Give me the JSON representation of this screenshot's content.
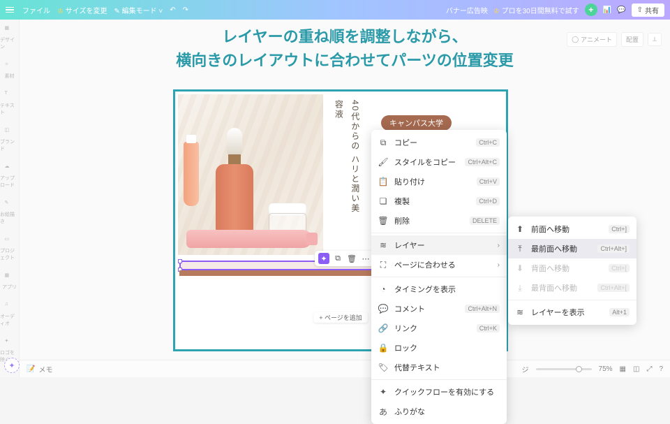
{
  "topbar": {
    "file": "ファイル",
    "resize": "サイズを変更",
    "edit_mode": "編集モード",
    "project_name": "バナー広告映",
    "pro_trial": "プロを30日間無料で試す",
    "share": "共有"
  },
  "sidebar": {
    "items": [
      {
        "label": "デザイン",
        "icon": "design"
      },
      {
        "label": "素材",
        "icon": "elements"
      },
      {
        "label": "テキスト",
        "icon": "text"
      },
      {
        "label": "ブランド",
        "icon": "brand"
      },
      {
        "label": "アップロード",
        "icon": "upload"
      },
      {
        "label": "お絵描き",
        "icon": "draw"
      },
      {
        "label": "プロジェクト",
        "icon": "projects"
      },
      {
        "label": "アプリ",
        "icon": "apps"
      },
      {
        "label": "オーディオ",
        "icon": "audio"
      },
      {
        "label": "ロゴを除く",
        "icon": "logo"
      }
    ]
  },
  "annotation": {
    "line1": "レイヤーの重ね順を調整しながら、",
    "line2": "横向きのレイアウトに合わせてパーツの位置変更"
  },
  "tool_row": {
    "animate": "アニメート",
    "position": "配置"
  },
  "design": {
    "vertical_text": "40代からの\nハリと潤い美容液",
    "brand_pill": "キャンパス大学",
    "page_indicator": "+ ページを追加"
  },
  "context_menu": {
    "copy": {
      "label": "コピー",
      "shortcut": "Ctrl+C"
    },
    "copy_style": {
      "label": "スタイルをコピー",
      "shortcut": "Ctrl+Alt+C"
    },
    "paste": {
      "label": "貼り付け",
      "shortcut": "Ctrl+V"
    },
    "duplicate": {
      "label": "複製",
      "shortcut": "Ctrl+D"
    },
    "delete": {
      "label": "削除",
      "shortcut": "DELETE"
    },
    "layer": {
      "label": "レイヤー"
    },
    "fit_page": {
      "label": "ページに合わせる"
    },
    "timing": {
      "label": "タイミングを表示"
    },
    "comment": {
      "label": "コメント",
      "shortcut": "Ctrl+Alt+N"
    },
    "link": {
      "label": "リンク",
      "shortcut": "Ctrl+K"
    },
    "lock": {
      "label": "ロック"
    },
    "alt_text": {
      "label": "代替テキスト"
    },
    "quickflow": {
      "label": "クイックフローを有効にする"
    },
    "furigana": {
      "label": "ふりがな"
    }
  },
  "sub_menu": {
    "forward": {
      "label": "前面へ移動",
      "shortcut": "Ctrl+]"
    },
    "to_front": {
      "label": "最前面へ移動",
      "shortcut": "Ctrl+Alt+]"
    },
    "backward": {
      "label": "背面へ移動",
      "shortcut": "Ctrl+["
    },
    "to_back": {
      "label": "最背面へ移動",
      "shortcut": "Ctrl+Alt+["
    },
    "show_layers": {
      "label": "レイヤーを表示",
      "shortcut": "Alt+1"
    }
  },
  "footer": {
    "notes": "メモ",
    "zoom": "75%"
  }
}
